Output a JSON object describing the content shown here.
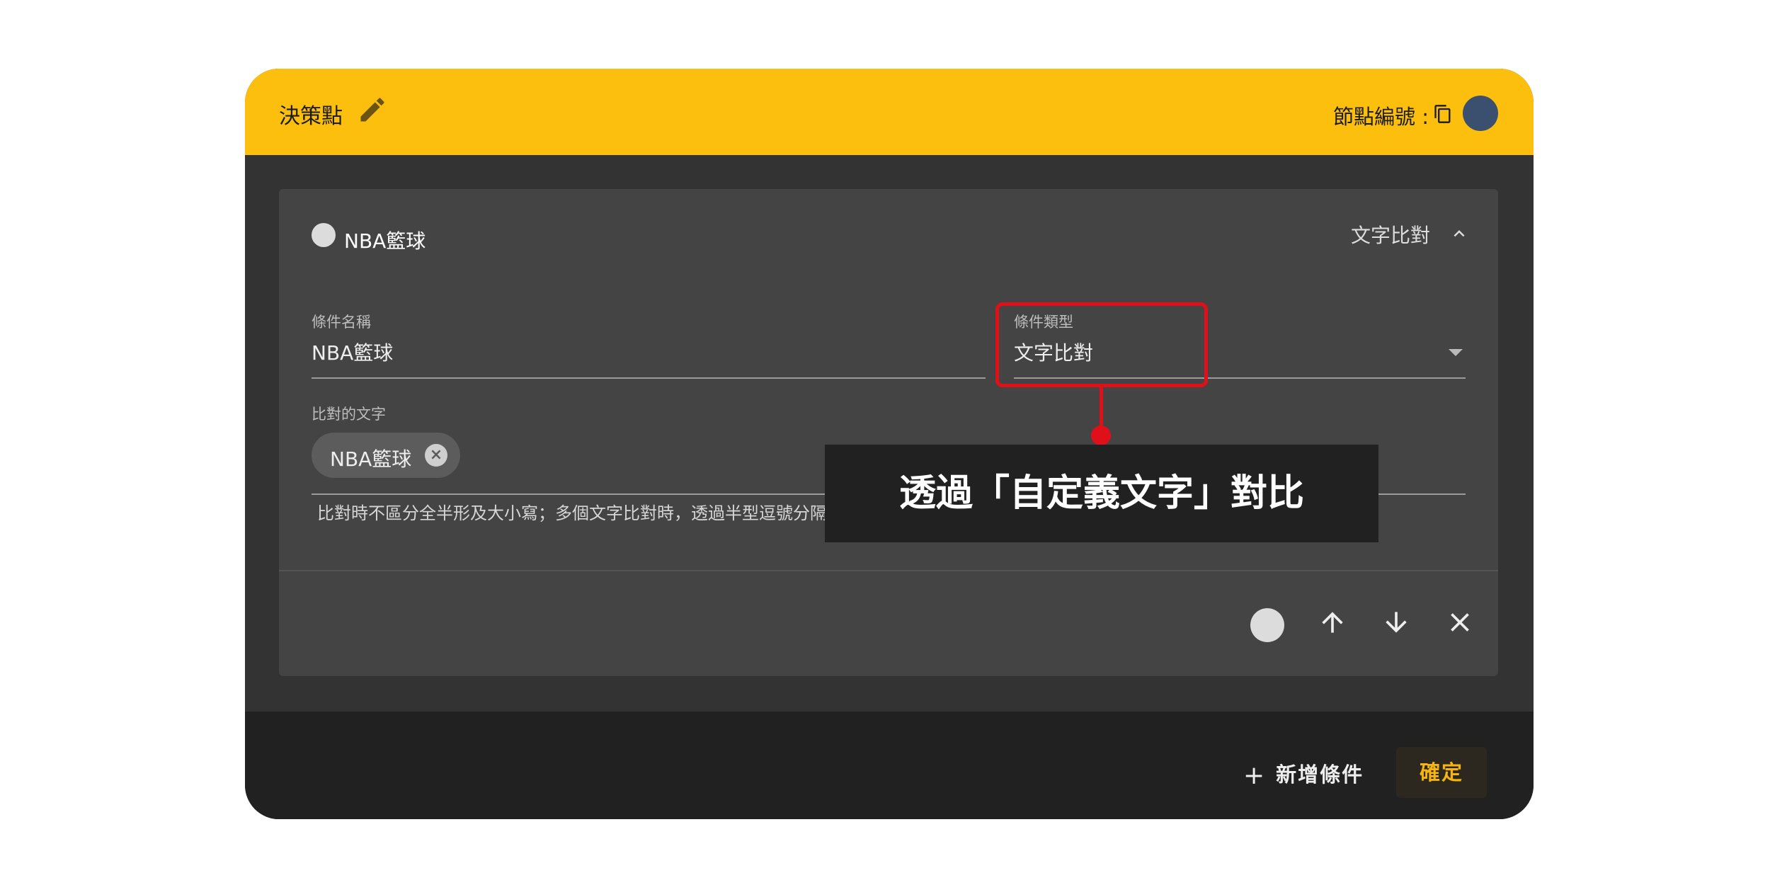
{
  "header": {
    "title": "決策點",
    "node_id_label": "節點編號 :"
  },
  "card": {
    "title": "NBA籃球",
    "type_label": "文字比對",
    "condition_name": {
      "label": "條件名稱",
      "value": "NBA籃球"
    },
    "condition_type": {
      "label": "條件類型",
      "value": "文字比對"
    },
    "compare_text": {
      "label": "比對的文字",
      "chips": [
        "NBA籃球"
      ],
      "helper": "比對時不區分全半形及大小寫；多個文字比對時，透過半型逗號分隔，例如: hi, hello"
    }
  },
  "footer": {
    "add_condition_label": "新增條件",
    "confirm_label": "確定"
  },
  "callout": {
    "text": "透過「自定義文字」對比"
  },
  "colors": {
    "header_bg": "#fdbf0e",
    "dialog_bg": "#333333",
    "card_bg": "#444444",
    "bottom_bar_bg": "#212121",
    "accent": "#f5b50e",
    "highlight": "#e0101a",
    "avatar": "#3b4f6e"
  },
  "icons": {
    "edit": "pencil-icon",
    "copy": "copy-icon",
    "collapse": "chevron-up-icon",
    "dropdown": "dropdown-arrow-icon",
    "chip_remove": "close-circle-icon",
    "move_up": "arrow-up-icon",
    "move_down": "arrow-down-icon",
    "delete": "close-icon",
    "add": "plus-icon"
  }
}
